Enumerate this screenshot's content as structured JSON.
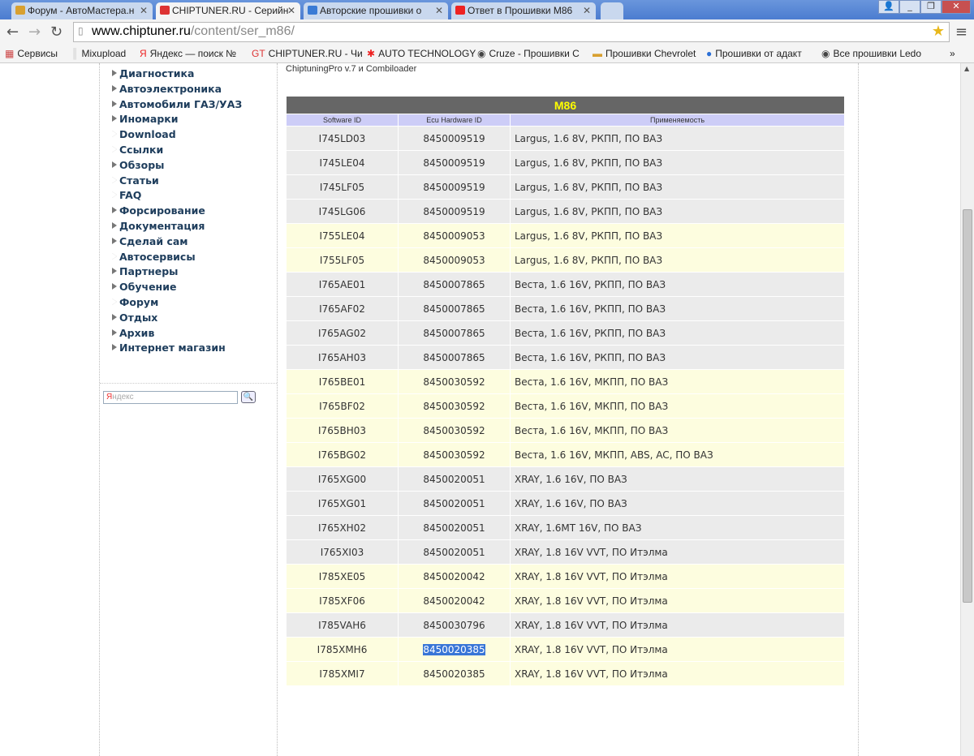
{
  "tabs": [
    {
      "label": "Форум - АвтоМастера.н",
      "icon": "car-icon",
      "color": "#d8a030"
    },
    {
      "label": "CHIPTUNER.RU - Серийн",
      "icon": "chiptuner-logo-icon",
      "color": "#d33"
    },
    {
      "label": "Авторские прошивки о",
      "icon": "v-logo-icon",
      "color": "#3a7bd5"
    },
    {
      "label": "Ответ в Прошивки M86",
      "icon": "red-flower-icon",
      "color": "#e22"
    }
  ],
  "address": {
    "host": "www.chiptuner.ru",
    "path": "/content/ser_m86/"
  },
  "bookmarks": [
    {
      "label": "Сервисы",
      "icon": "apps-icon"
    },
    {
      "label": "Mixupload",
      "icon": "bars-icon"
    },
    {
      "label": "Яндекс — поиск №",
      "icon": "yandex-icon"
    },
    {
      "label": "CHIPTUNER.RU - Чи",
      "icon": "chiptuner-logo-icon"
    },
    {
      "label": "AUTO TECHNOLOGY",
      "icon": "red-flower-icon"
    },
    {
      "label": "Cruze - Прошивки С",
      "icon": "globe-icon"
    },
    {
      "label": "Прошивки Chevrolet",
      "icon": "car-icon"
    },
    {
      "label": "Прошивки от адакт",
      "icon": "blue-circle-icon"
    },
    {
      "label": "Все прошивки Ledo",
      "icon": "globe-icon"
    }
  ],
  "bookmarks_more": "»",
  "sidebar": [
    "Диагностика",
    "Автоэлектроника",
    "Автомобили ГАЗ/УАЗ",
    "Иномарки",
    "Download",
    "Ссылки",
    "Обзоры",
    "Статьи",
    "FAQ",
    "Форсирование",
    "Документация",
    "Сделай сам",
    "Автосервисы",
    "Партнеры",
    "Обучение",
    "Форум",
    "Отдых",
    "Архив",
    "Интернет магазин"
  ],
  "search": {
    "placeholder": "Яндекс"
  },
  "intro": "ChiptuningPro v.7 и Combiloader",
  "table": {
    "title": "M86",
    "headers": [
      "Software ID",
      "Ecu Hardware ID",
      "Применяемость"
    ],
    "rows": [
      [
        "I745LD03",
        "8450009519",
        "Largus, 1.6 8V, РКПП, ПО ВАЗ",
        "g"
      ],
      [
        "I745LE04",
        "8450009519",
        "Largus, 1.6 8V, РКПП, ПО ВАЗ",
        "g"
      ],
      [
        "I745LF05",
        "8450009519",
        "Largus, 1.6 8V, РКПП, ПО ВАЗ",
        "g"
      ],
      [
        "I745LG06",
        "8450009519",
        "Largus, 1.6 8V, РКПП, ПО ВАЗ",
        "g"
      ],
      [
        "I755LE04",
        "8450009053",
        "Largus, 1.6 8V, РКПП, ПО ВАЗ",
        "y"
      ],
      [
        "I755LF05",
        "8450009053",
        "Largus, 1.6 8V, РКПП, ПО ВАЗ",
        "y"
      ],
      [
        "I765AE01",
        "8450007865",
        "Веста, 1.6 16V, РКПП, ПО ВАЗ",
        "g"
      ],
      [
        "I765AF02",
        "8450007865",
        "Веста, 1.6 16V, РКПП, ПО ВАЗ",
        "g"
      ],
      [
        "I765AG02",
        "8450007865",
        "Веста, 1.6 16V, РКПП, ПО ВАЗ",
        "g"
      ],
      [
        "I765AH03",
        "8450007865",
        "Веста, 1.6 16V, РКПП, ПО ВАЗ",
        "g"
      ],
      [
        "I765BE01",
        "8450030592",
        "Веста, 1.6 16V, МКПП, ПО ВАЗ",
        "y"
      ],
      [
        "I765BF02",
        "8450030592",
        "Веста, 1.6 16V, МКПП, ПО ВАЗ",
        "y"
      ],
      [
        "I765BH03",
        "8450030592",
        "Веста, 1.6 16V, МКПП, ПО ВАЗ",
        "y"
      ],
      [
        "I765BG02",
        "8450030592",
        "Веста, 1.6 16V, МКПП, ABS, AC, ПО ВАЗ",
        "y"
      ],
      [
        "I765XG00",
        "8450020051",
        "XRAY, 1.6 16V, ПО ВАЗ",
        "g"
      ],
      [
        "I765XG01",
        "8450020051",
        "XRAY, 1.6 16V, ПО ВАЗ",
        "g"
      ],
      [
        "I765XH02",
        "8450020051",
        "XRAY, 1.6MT 16V, ПО ВАЗ",
        "g"
      ],
      [
        "I765XI03",
        "8450020051",
        "XRAY, 1.8 16V VVT, ПО Итэлма",
        "g"
      ],
      [
        "I785XE05",
        "8450020042",
        "XRAY, 1.8 16V VVT, ПО Итэлма",
        "y"
      ],
      [
        "I785XF06",
        "8450020042",
        "XRAY, 1.8 16V VVT, ПО Итэлма",
        "y"
      ],
      [
        "I785VAH6",
        "8450030796",
        "XRAY, 1.8 16V VVT, ПО Итэлма",
        "g"
      ],
      [
        "I785XMH6",
        "8450020385",
        "XRAY, 1.8 16V VVT, ПО Итэлма",
        "y"
      ],
      [
        "I785XMI7",
        "8450020385",
        "XRAY, 1.8 16V VVT, ПО Итэлма",
        "y"
      ]
    ],
    "selected_row": 21
  }
}
